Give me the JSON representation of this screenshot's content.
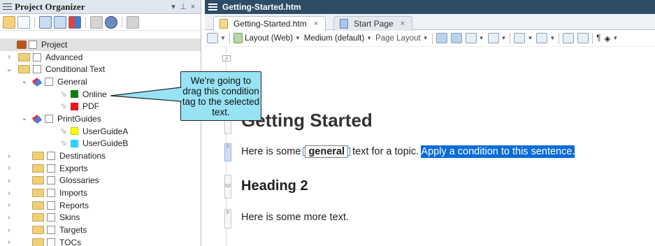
{
  "left_panel": {
    "title": "Project Organizer",
    "pin_icon": "pin-icon",
    "close_icon": "close-icon",
    "dropdown_icon": "triangle-down-icon",
    "tree": [
      {
        "label": "Project",
        "type": "root",
        "selected": true
      },
      {
        "label": "Advanced",
        "type": "folder",
        "expanded": false
      },
      {
        "label": "Conditional Text",
        "type": "folder",
        "expanded": true
      },
      {
        "label": "General",
        "type": "condition-set",
        "expanded": true
      },
      {
        "label": "Online",
        "type": "condition",
        "color": "#0f7b0f"
      },
      {
        "label": "PDF",
        "type": "condition",
        "color": "#e8131b"
      },
      {
        "label": "PrintGuides",
        "type": "condition-set",
        "expanded": true
      },
      {
        "label": "UserGuideA",
        "type": "condition",
        "color": "#ffff00"
      },
      {
        "label": "UserGuideB",
        "type": "condition",
        "color": "#2ed0ff"
      },
      {
        "label": "Destinations",
        "type": "folder",
        "expanded": false
      },
      {
        "label": "Exports",
        "type": "folder",
        "expanded": false
      },
      {
        "label": "Glossaries",
        "type": "folder",
        "expanded": false
      },
      {
        "label": "Imports",
        "type": "folder",
        "expanded": false
      },
      {
        "label": "Reports",
        "type": "folder",
        "expanded": false
      },
      {
        "label": "Skins",
        "type": "folder",
        "expanded": false
      },
      {
        "label": "Targets",
        "type": "folder",
        "expanded": false
      },
      {
        "label": "TOCs",
        "type": "folder",
        "expanded": false
      }
    ]
  },
  "right_panel": {
    "title": "Getting-Started.htm",
    "tabs": [
      {
        "label": "Getting-Started.htm",
        "active": true
      },
      {
        "label": "Start Page",
        "active": false
      }
    ],
    "toolbar": {
      "layout": "Layout (Web)",
      "medium": "Medium (default)",
      "page_layout": "Page Layout"
    },
    "document": {
      "heading1": "Getting Started",
      "para1_before": "Here is some ",
      "para1_tag": "general",
      "para1_after": " text for a topic. ",
      "para1_selected": "Apply a condition to this sentence.",
      "heading2": "Heading 2",
      "para2": "Here is some more text."
    },
    "block_marks": [
      "p",
      "p",
      "h2",
      "p"
    ]
  },
  "callout": {
    "text": "We're going to drag this condition tag to the selected text."
  }
}
